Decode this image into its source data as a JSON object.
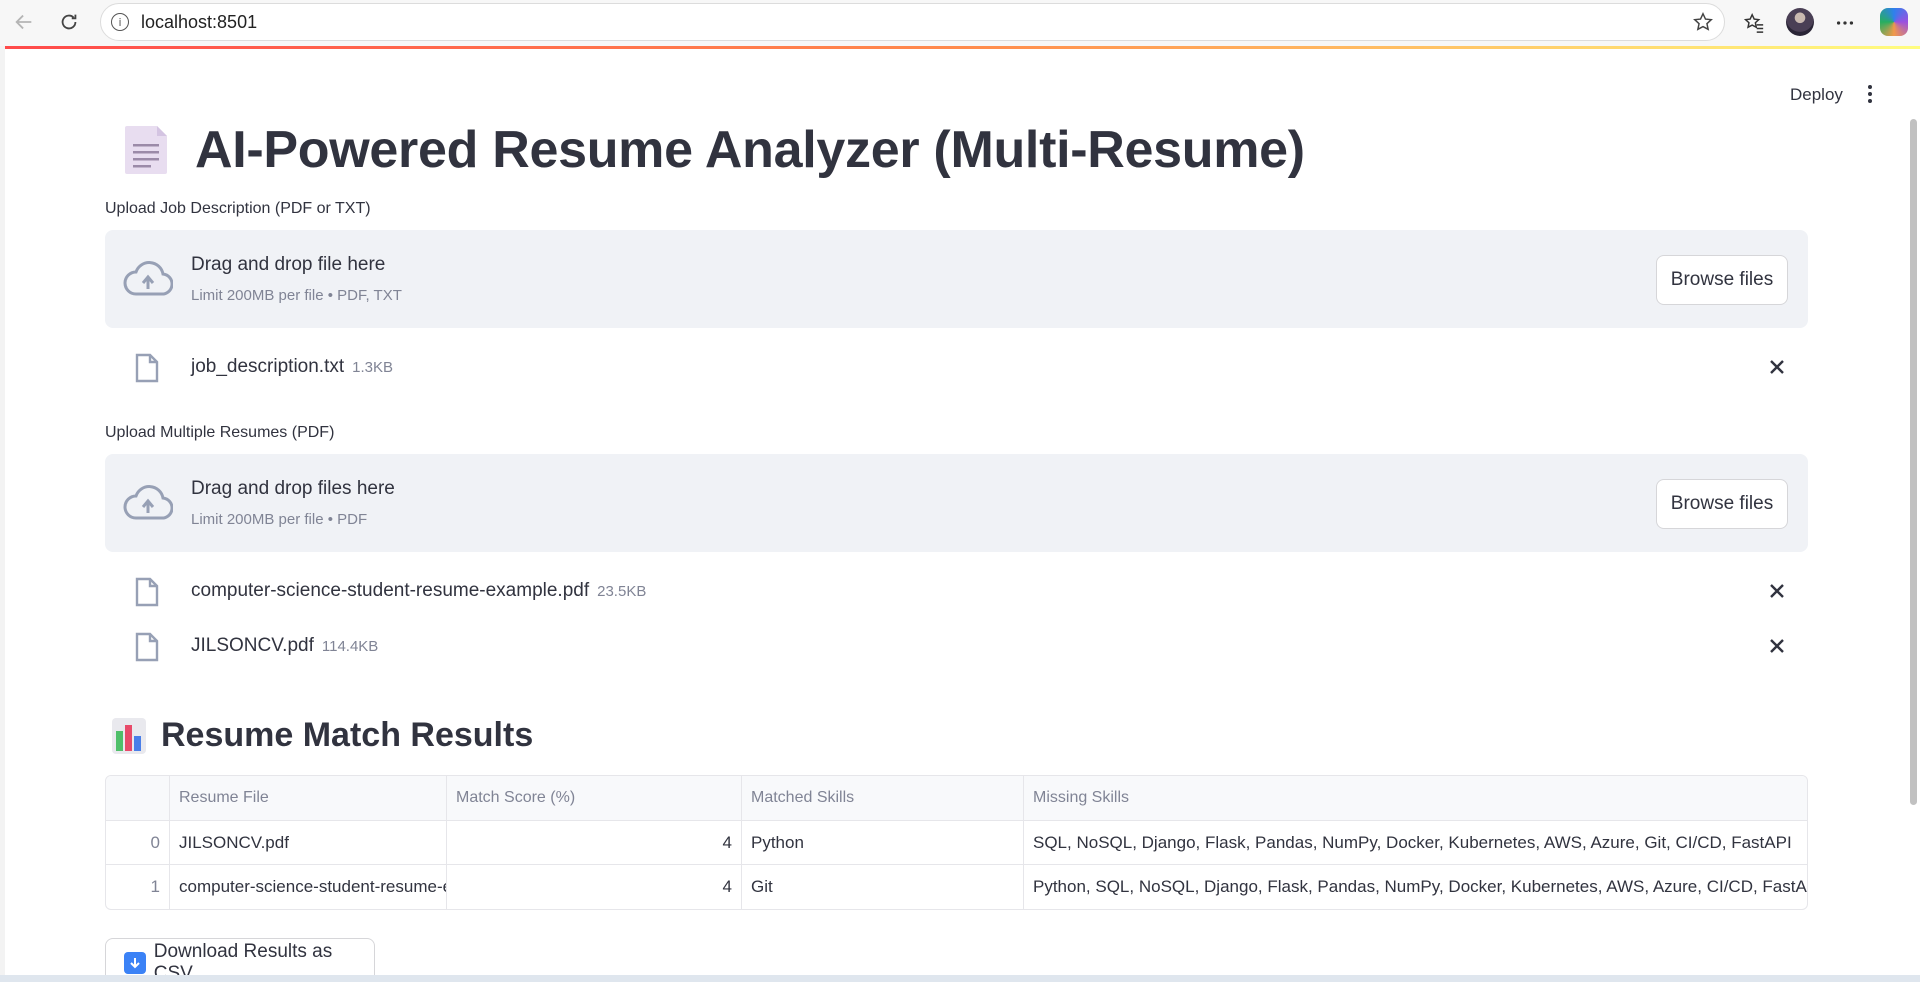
{
  "browser": {
    "url": "localhost:8501"
  },
  "header": {
    "deploy_label": "Deploy"
  },
  "page": {
    "title": "AI-Powered Resume Analyzer (Multi-Resume)"
  },
  "job_upload": {
    "label": "Upload Job Description (PDF or TXT)",
    "drop_title": "Drag and drop file here",
    "drop_limit": "Limit 200MB per file • PDF, TXT",
    "browse_label": "Browse files",
    "files": [
      {
        "name": "job_description.txt",
        "size": "1.3KB"
      }
    ]
  },
  "resume_upload": {
    "label": "Upload Multiple Resumes (PDF)",
    "drop_title": "Drag and drop files here",
    "drop_limit": "Limit 200MB per file • PDF",
    "browse_label": "Browse files",
    "files": [
      {
        "name": "computer-science-student-resume-example.pdf",
        "size": "23.5KB"
      },
      {
        "name": "JILSONCV.pdf",
        "size": "114.4KB"
      }
    ]
  },
  "results": {
    "heading": "Resume Match Results",
    "columns": [
      "",
      "Resume File",
      "Match Score (%)",
      "Matched Skills",
      "Missing Skills"
    ],
    "rows": [
      {
        "index": "0",
        "file": "JILSONCV.pdf",
        "score": "4",
        "matched": "Python",
        "missing": "SQL, NoSQL, Django, Flask, Pandas, NumPy, Docker, Kubernetes, AWS, Azure, Git, CI/CD, FastAPI"
      },
      {
        "index": "1",
        "file": "computer-science-student-resume-example.pdf",
        "score": "4",
        "matched": "Git",
        "missing": "Python, SQL, NoSQL, Django, Flask, Pandas, NumPy, Docker, Kubernetes, AWS, Azure, CI/CD, FastAPI"
      }
    ],
    "download_label": "Download Results as CSV"
  },
  "colors": {
    "accent_start": "#ff4b4b",
    "accent_end": "#fffd80",
    "dropzone_bg": "#f0f2f6",
    "text": "#31333f",
    "muted": "#808495"
  }
}
